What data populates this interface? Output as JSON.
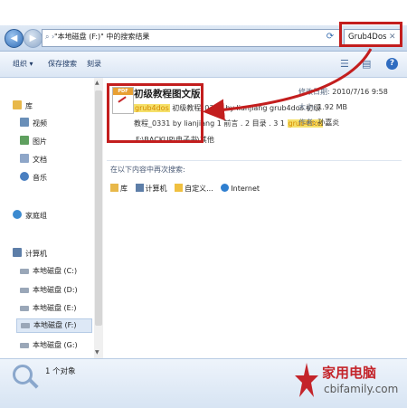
{
  "window": {
    "address_text": "\"本地磁盘 (F:)\" 中的搜索结果",
    "search_value": "Grub4Dos"
  },
  "toolbar": {
    "organize": "组织 ▾",
    "save_search": "保存搜索",
    "burn": "刻录"
  },
  "nav": {
    "items": [
      {
        "label": "库",
        "icon": "library-icon",
        "color": "#e8b84a"
      },
      {
        "label": "视频",
        "icon": "video-icon",
        "color": "#6a8fb8"
      },
      {
        "label": "图片",
        "icon": "picture-icon",
        "color": "#5fa05f"
      },
      {
        "label": "文档",
        "icon": "document-icon",
        "color": "#8ea6c8"
      },
      {
        "label": "音乐",
        "icon": "music-icon",
        "color": "#4a7fc0"
      },
      {
        "label": "家庭组",
        "icon": "homegroup-icon",
        "color": "#3b8ad0"
      },
      {
        "label": "计算机",
        "icon": "computer-icon",
        "color": "#5d7ea8"
      },
      {
        "label": "本地磁盘 (C:)",
        "icon": "drive-icon",
        "color": "#9aa7b8"
      },
      {
        "label": "本地磁盘 (D:)",
        "icon": "drive-icon",
        "color": "#9aa7b8"
      },
      {
        "label": "本地磁盘 (E:)",
        "icon": "drive-icon",
        "color": "#9aa7b8"
      },
      {
        "label": "本地磁盘 (F:)",
        "icon": "drive-icon",
        "color": "#9aa7b8"
      },
      {
        "label": "本地磁盘 (G:)",
        "icon": "drive-icon",
        "color": "#9aa7b8"
      }
    ]
  },
  "result": {
    "title": "初级教程图文版",
    "line2_hl": "grub4dos",
    "line2_rest": " 初级教程_0331 by lianjiang grub4dos 初级",
    "line3_pre": "教程_0331 by lianjiang 1 前言 . 2 目录 . 3 1 ",
    "line3_hl": "grub4dos",
    "line3_post": " ...",
    "path": "F:\\BACKUP\\电子书\\其他",
    "modified_label": "修改日期:",
    "modified_value": "2010/7/16 9:58",
    "size_label": "大小:",
    "size_value": "1.92 MB",
    "author_label": "作者:",
    "author_value": "孙嘉炎"
  },
  "search_again": {
    "label": "在以下内容中再次搜索:",
    "links": [
      {
        "label": "库",
        "icon": "library-icon"
      },
      {
        "label": "计算机",
        "icon": "computer-icon"
      },
      {
        "label": "自定义...",
        "icon": "custom-folder-icon"
      },
      {
        "label": "Internet",
        "icon": "internet-icon"
      }
    ]
  },
  "status": {
    "count": "1 个对象"
  },
  "watermark": {
    "brand": "家用电脑",
    "url": "cbifamily.com"
  },
  "colors": {
    "highlight_border": "#c31e1e",
    "search_match_bg": "#f5e06a"
  }
}
